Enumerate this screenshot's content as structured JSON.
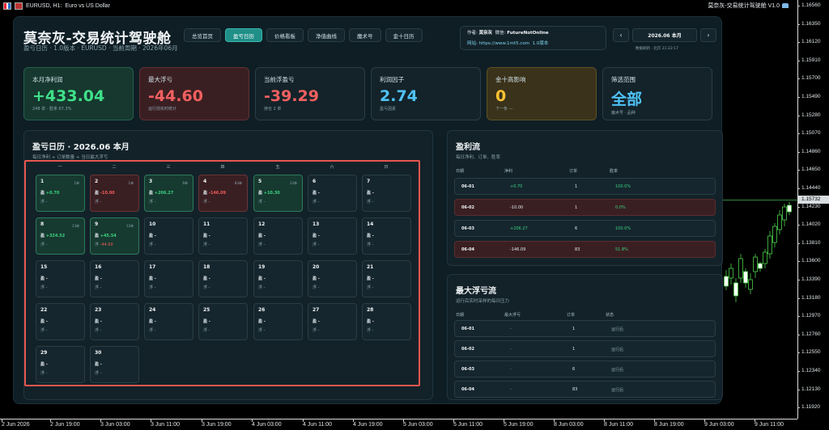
{
  "terminal": {
    "symbol": "EURUSD, H1:",
    "symbol_desc": "Euro vs US Dollar",
    "ea_name": "莫奈灰-交易统计驾驶舱 V1.0",
    "current_price": "1.15732",
    "prices": [
      "1.16560",
      "1.16350",
      "1.16120",
      "1.15910",
      "1.15700",
      "1.15490",
      "1.15280",
      "1.15070",
      "1.14860",
      "1.14650",
      "1.14440",
      "1.14230",
      "1.14020",
      "1.13810",
      "1.13600",
      "1.13390",
      "1.13180",
      "1.12970",
      "1.12760",
      "1.12550",
      "1.12340",
      "1.12130",
      "1.11920"
    ],
    "price_labels": [
      "1.16560",
      "1.16350",
      "1.16120",
      "1.15910",
      "1.15700",
      "1.15490",
      "1.15280",
      "1.15070",
      "1.14860",
      "1.14650",
      "1.14440",
      "1.14230",
      "1.14020",
      "1.13810",
      "1.13600",
      "1.13390",
      "1.13180",
      "1.12970",
      "1.12760",
      "1.12550",
      "1.12340",
      "1.12130",
      "1.11920"
    ],
    "times": [
      "2 Jun 2026",
      "2 Jun 19:00",
      "3 Jun 03:00",
      "3 Jun 11:00",
      "3 Jun 19:00",
      "4 Jun 03:00",
      "4 Jun 11:00",
      "4 Jun 19:00",
      "5 Jun 03:00",
      "5 Jun 11:00",
      "5 Jun 19:00",
      "8 Jun 03:00",
      "8 Jun 11:00",
      "8 Jun 19:00",
      "9 Jun 03:00",
      "9 Jun 11:00"
    ]
  },
  "header": {
    "title": "莫奈灰-交易统计驾驶舱",
    "subtitle": "盈亏日历 · 1.0版本 · EURUSD · 当前周期 · 2026年06月"
  },
  "tabs": [
    "总览首页",
    "盈亏日历",
    "价格看板",
    "净值曲线",
    "魔术号",
    "金十日历"
  ],
  "active_tab": 1,
  "author": {
    "label_author": "作者:",
    "author": "莫奈灰",
    "label_wechat": "微信:",
    "wechat": "FutureNotOnline",
    "label_site": "网站:",
    "site": "https://www.1mt5.com",
    "version": "1.0版本"
  },
  "nav": {
    "prev": "‹",
    "date": "2026.06 本月",
    "next": "›",
    "update": "数据刷新 · 北京 21:22:17"
  },
  "kpis": [
    {
      "label": "本月净利润",
      "value": "+433.04",
      "sub": "248 单 · 胜率 67.3%",
      "tone": "green",
      "color": "#3fe08a"
    },
    {
      "label": "最大浮亏",
      "value": "-44.60",
      "sub": "运行前实时统计",
      "tone": "red",
      "color": "#f26060"
    },
    {
      "label": "当前浮盈亏",
      "value": "-39.29",
      "sub": "持仓 2 单",
      "tone": "plain",
      "color": "#f26060"
    },
    {
      "label": "利润因子",
      "value": "2.74",
      "sub": "盈亏因素",
      "tone": "plain",
      "color": "#4fc3f7"
    },
    {
      "label": "金十高影响",
      "value": "0",
      "sub": "下一条 —",
      "tone": "yellow",
      "color": "#ffc233"
    },
    {
      "label": "筛选范围",
      "value": "全部",
      "sub": "魔术号 · 品种",
      "tone": "plain",
      "color": "#4fc3f7"
    }
  ],
  "calendar": {
    "title": "盈亏日历 · 2026.06 本月",
    "subtitle": "每日净利 + 订单数量 + 当日最大浮亏",
    "weekdays": [
      "一",
      "二",
      "三",
      "四",
      "五",
      "六",
      "日"
    ],
    "pl_label": "盈",
    "fl_label": "浮",
    "days": [
      {
        "n": "1",
        "count": "1单",
        "pl": "+0.70",
        "fl": "-",
        "tone": "g"
      },
      {
        "n": "2",
        "count": "1单",
        "pl": "-10.00",
        "fl": "-",
        "tone": "r"
      },
      {
        "n": "3",
        "count": "6单",
        "pl": "+206.27",
        "fl": "-",
        "tone": "g"
      },
      {
        "n": "4",
        "count": "83单",
        "pl": "-146.09",
        "fl": "-",
        "tone": "r"
      },
      {
        "n": "5",
        "count": "12单",
        "pl": "+10.30",
        "fl": "-",
        "tone": "g"
      },
      {
        "n": "6",
        "count": "",
        "pl": "-",
        "fl": "-",
        "tone": ""
      },
      {
        "n": "7",
        "count": "",
        "pl": "-",
        "fl": "-",
        "tone": ""
      },
      {
        "n": "8",
        "count": "13单",
        "pl": "+324.52",
        "fl": "-",
        "tone": "g"
      },
      {
        "n": "9",
        "count": "12单",
        "pl": "+45.54",
        "fl": "-44.60",
        "tone": "g"
      },
      {
        "n": "10",
        "count": "",
        "pl": "-",
        "fl": "-",
        "tone": ""
      },
      {
        "n": "11",
        "count": "",
        "pl": "-",
        "fl": "-",
        "tone": ""
      },
      {
        "n": "12",
        "count": "",
        "pl": "-",
        "fl": "-",
        "tone": ""
      },
      {
        "n": "13",
        "count": "",
        "pl": "-",
        "fl": "-",
        "tone": ""
      },
      {
        "n": "14",
        "count": "",
        "pl": "-",
        "fl": "-",
        "tone": ""
      },
      {
        "n": "15",
        "count": "",
        "pl": "-",
        "fl": "-",
        "tone": ""
      },
      {
        "n": "16",
        "count": "",
        "pl": "-",
        "fl": "-",
        "tone": ""
      },
      {
        "n": "17",
        "count": "",
        "pl": "-",
        "fl": "-",
        "tone": ""
      },
      {
        "n": "18",
        "count": "",
        "pl": "-",
        "fl": "-",
        "tone": ""
      },
      {
        "n": "19",
        "count": "",
        "pl": "-",
        "fl": "-",
        "tone": ""
      },
      {
        "n": "20",
        "count": "",
        "pl": "-",
        "fl": "-",
        "tone": ""
      },
      {
        "n": "21",
        "count": "",
        "pl": "-",
        "fl": "-",
        "tone": ""
      },
      {
        "n": "22",
        "count": "",
        "pl": "-",
        "fl": "-",
        "tone": ""
      },
      {
        "n": "23",
        "count": "",
        "pl": "-",
        "fl": "-",
        "tone": ""
      },
      {
        "n": "24",
        "count": "",
        "pl": "-",
        "fl": "-",
        "tone": ""
      },
      {
        "n": "25",
        "count": "",
        "pl": "-",
        "fl": "-",
        "tone": ""
      },
      {
        "n": "26",
        "count": "",
        "pl": "-",
        "fl": "-",
        "tone": ""
      },
      {
        "n": "27",
        "count": "",
        "pl": "-",
        "fl": "-",
        "tone": ""
      },
      {
        "n": "28",
        "count": "",
        "pl": "-",
        "fl": "-",
        "tone": ""
      },
      {
        "n": "29",
        "count": "",
        "pl": "-",
        "fl": "-",
        "tone": ""
      },
      {
        "n": "30",
        "count": "",
        "pl": "-",
        "fl": "-",
        "tone": ""
      }
    ]
  },
  "profit_flow": {
    "title": "盈利流",
    "subtitle": "每日净利、订单、胜率",
    "headers": [
      "日期",
      "净利",
      "订单",
      "胜率"
    ],
    "rows": [
      {
        "date": "06-01",
        "profit": "+0.70",
        "orders": "1",
        "rate": "100.0%",
        "tone": ""
      },
      {
        "date": "06-02",
        "profit": "-10.00",
        "orders": "1",
        "rate": "0.0%",
        "tone": "r"
      },
      {
        "date": "06-03",
        "profit": "+206.27",
        "orders": "6",
        "rate": "100.0%",
        "tone": ""
      },
      {
        "date": "06-04",
        "profit": "-146.09",
        "orders": "83",
        "rate": "51.8%",
        "tone": "r"
      }
    ]
  },
  "float_flow": {
    "title": "最大浮亏流",
    "subtitle": "运行后实时采样的每日压力",
    "headers": [
      "日期",
      "最大浮亏",
      "订单",
      "状态"
    ],
    "rows": [
      {
        "date": "06-01",
        "loss": "-",
        "orders": "1",
        "status": "运行后"
      },
      {
        "date": "06-02",
        "loss": "-",
        "orders": "1",
        "status": "运行后"
      },
      {
        "date": "06-03",
        "loss": "-",
        "orders": "6",
        "status": "运行后"
      },
      {
        "date": "06-04",
        "loss": "-",
        "orders": "83",
        "status": "运行后"
      }
    ]
  }
}
